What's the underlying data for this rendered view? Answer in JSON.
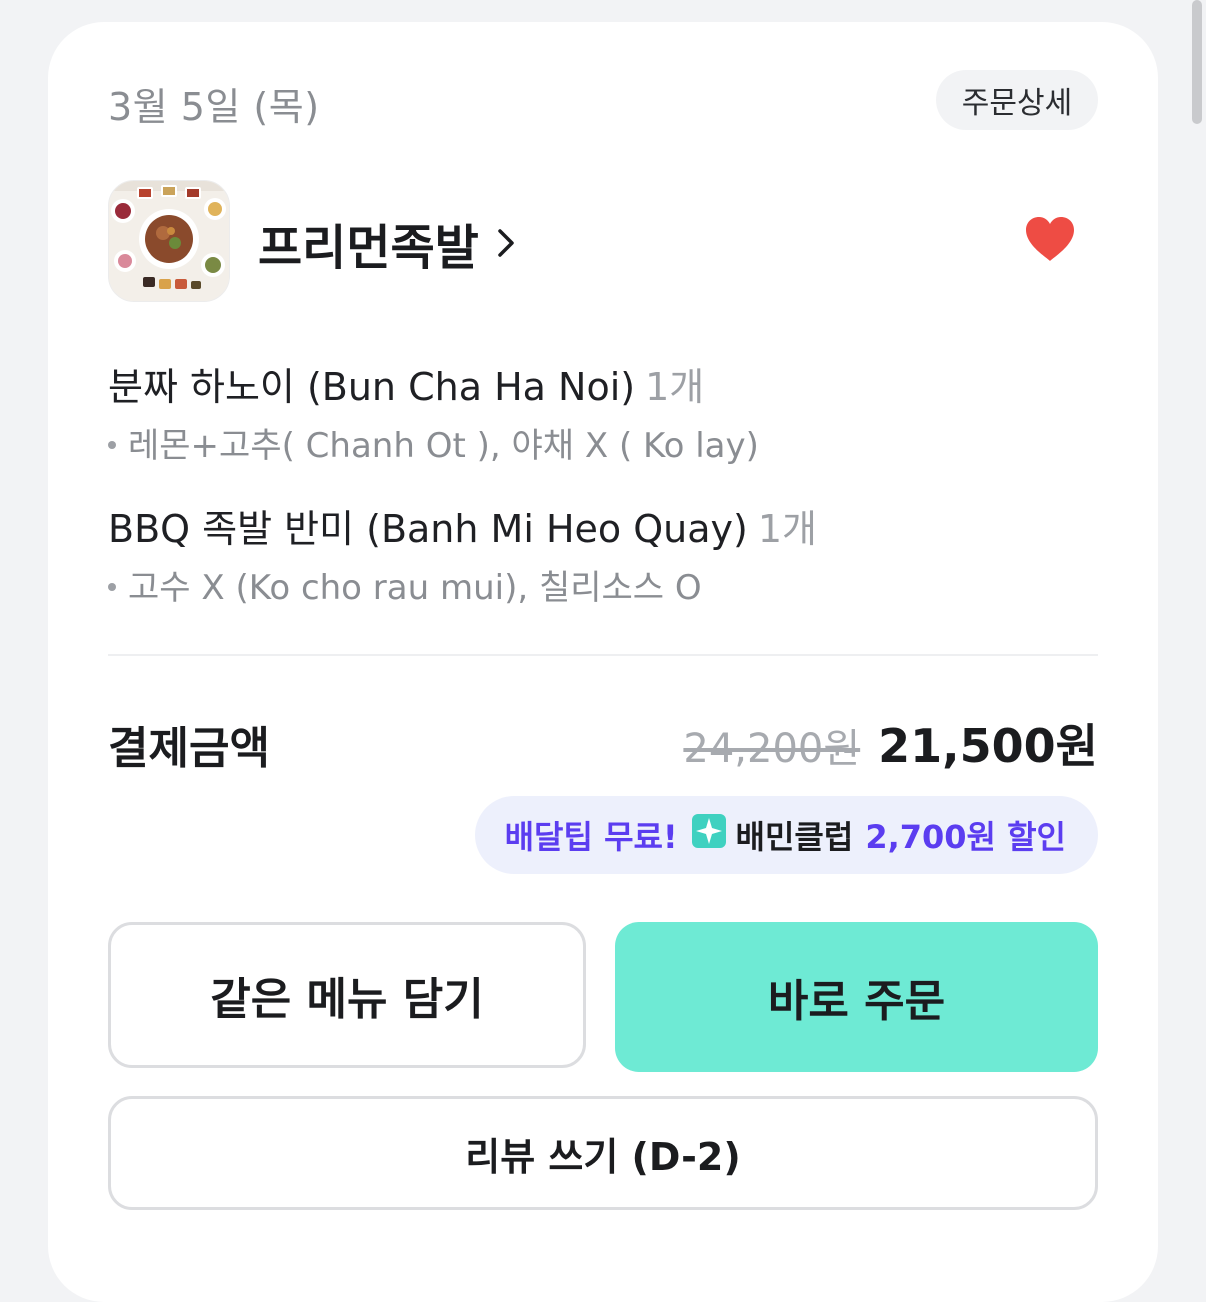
{
  "order": {
    "date": "3월 5일 (목)",
    "detail_label": "주문상세"
  },
  "store": {
    "name": "프리먼족발",
    "favorited": true,
    "icons": {
      "chevron": "chevron-right-icon",
      "favorite": "heart-icon"
    },
    "colors": {
      "heart": "#ee4c44"
    }
  },
  "items": [
    {
      "name": "분짜 하노이 (Bun Cha Ha Noi)",
      "qty": "1개",
      "options": "레몬+고추( Chanh Ot ), 야채 X ( Ko lay)"
    },
    {
      "name": "BBQ 족발 반미 (Banh Mi Heo Quay)",
      "qty": "1개",
      "options": "고수 X (Ko cho rau mui), 칠리소스 O"
    }
  ],
  "payment": {
    "label": "결제금액",
    "original_price": "24,200원",
    "final_price": "21,500원"
  },
  "promo": {
    "free_delivery": "배달팁 무료!",
    "club_name": "배민클럽",
    "discount": "2,700원 할인",
    "colors": {
      "accent": "#5b3df0",
      "background": "#edf0fc"
    }
  },
  "buttons": {
    "same_menu": "같은 메뉴 담기",
    "order_now": "바로 주문",
    "review": "리뷰 쓰기 (D-2)"
  },
  "colors": {
    "primary_button": "#6eead4"
  }
}
